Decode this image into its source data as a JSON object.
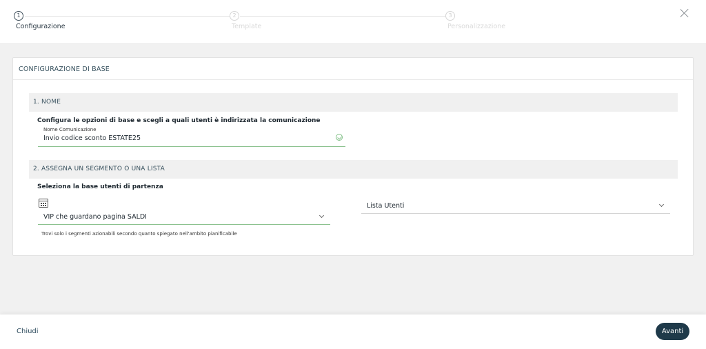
{
  "stepper": {
    "steps": [
      {
        "number": "1",
        "label": "Configurazione"
      },
      {
        "number": "2",
        "label": "Template"
      },
      {
        "number": "3",
        "label": "Personalizzazione"
      }
    ],
    "active_step": 1
  },
  "card": {
    "title": "CONFIGURAZIONE DI BASE"
  },
  "section_name": {
    "heading": "1. NOME",
    "description": "Configura le opzioni di base e scegli a quali utenti è indirizzata la comunicazione",
    "field_label": "Nome Comunicazione",
    "field_value": "Invio codice sconto ESTATE25"
  },
  "section_segment": {
    "heading": "2. ASSEGNA UN SEGMENTO O UNA LISTA",
    "description": "Seleziona la base utenti di partenza",
    "segment_value": "VIP che guardano pagina SALDI",
    "segment_hint": "Trovi solo i segmenti azionabili secondo quanto spiegato nell'ambito pianificabile",
    "list_value": "Lista Utenti"
  },
  "footer": {
    "close_label": "Chiudi",
    "next_label": "Avanti"
  },
  "colors": {
    "primary": "#1f3a4a",
    "valid_underline": "#8cc28f"
  }
}
